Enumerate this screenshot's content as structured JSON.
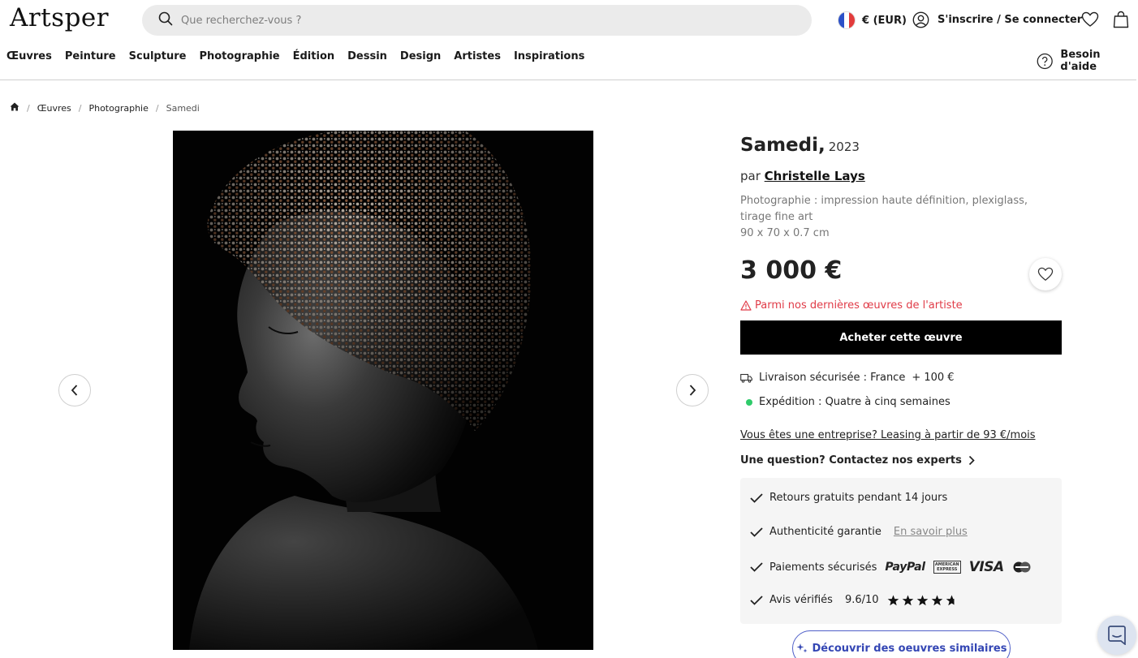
{
  "header": {
    "logo": "Artsper",
    "search_placeholder": "Que recherchez-vous ?",
    "currency": "€ (EUR)",
    "account": "S'inscrire / Se connecter",
    "help": "Besoin d'aide",
    "icons": [
      "search-icon",
      "flag-icon",
      "user-icon",
      "heart-icon",
      "bag-icon",
      "help-icon"
    ]
  },
  "nav": {
    "items": [
      "Œuvres",
      "Peinture",
      "Sculpture",
      "Photographie",
      "Édition",
      "Dessin",
      "Design",
      "Artistes",
      "Inspirations"
    ]
  },
  "breadcrumb": {
    "items": [
      "Œuvres",
      "Photographie"
    ],
    "current": "Samedi"
  },
  "product": {
    "title": "Samedi,",
    "year": "2023",
    "by_label": "par",
    "artist": "Christelle Lays",
    "description": "Photographie : impression haute définition, plexiglass, tirage fine art",
    "dimensions": "90 x 70 x 0.7 cm",
    "price": "3 000 €",
    "alert": "Parmi nos dernières œuvres de l'artiste",
    "buy_label": "Acheter cette œuvre",
    "shipping_label": "Livraison sécurisée : France",
    "shipping_cost": "+ 100 €",
    "dispatch": "Expédition : Quatre à cinq semaines",
    "leasing": "Vous êtes une entreprise? Leasing à partir de 93 €/mois",
    "question": "Une question? Contactez nos experts"
  },
  "guarantees": {
    "returns": "Retours gratuits pendant 14 jours",
    "authenticity": "Authenticité garantie",
    "learn_more": "En savoir plus",
    "payments": "Paiements sécurisés",
    "paypal": "PayPal",
    "amex": "AMERICAN EXPRESS",
    "visa": "VISA",
    "reviews": "Avis vérifiés",
    "score": "9.6/10",
    "rating": 4.8
  },
  "similar_label": "Découvrir des oeuvres similaires",
  "colors": {
    "alert": "#e03b47",
    "accent": "#3446b4",
    "dispatch_dot": "#2fcb6a",
    "buy_button": "#000000"
  }
}
